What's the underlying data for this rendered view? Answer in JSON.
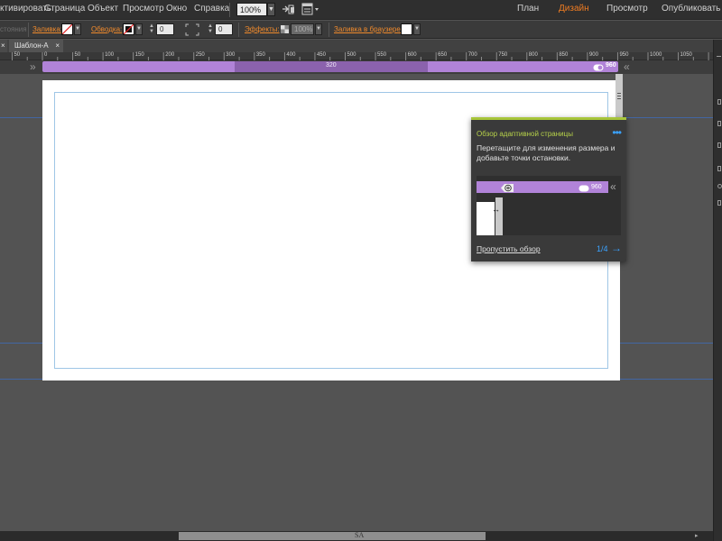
{
  "menu": {
    "items": [
      "ктивировать",
      "Страница",
      "Объект",
      "Просмотр",
      "Окно",
      "Справка"
    ],
    "zoom": "100%",
    "modes": [
      "План",
      "Дизайн",
      "Просмотр",
      "Опубликовать"
    ],
    "active_mode": "Дизайн",
    "accent_color": "#f07c22"
  },
  "controls": {
    "state_label": "стояния",
    "fill_label": "Заливка:",
    "stroke_label": "Обводка:",
    "stroke_width": "0",
    "radius": "0",
    "effects_label": "Эффекты:",
    "opacity": "100%",
    "browser_fill_label": "Заливка в браузере:"
  },
  "tabs": [
    {
      "label": "",
      "close": "×"
    },
    {
      "label": "Шаблон-А",
      "close": "×"
    }
  ],
  "ruler": {
    "ticks": [
      "50",
      "0",
      "50",
      "100",
      "150",
      "200",
      "250",
      "300",
      "350",
      "400",
      "450",
      "500",
      "550",
      "600",
      "650",
      "700",
      "750",
      "800",
      "850",
      "900",
      "950",
      "1000",
      "1050"
    ]
  },
  "breakpoints": {
    "left_chevron": "»",
    "right_chevron": "«",
    "marker_label": "320",
    "current_width": "960",
    "bar_color": "#b183d8",
    "marker_color": "#8b62ad"
  },
  "tour": {
    "title": "Обзор адаптивной страницы",
    "more": "•••",
    "body": "Перетащите для изменения размера и добавьте точки остановки.",
    "preview_width": "960",
    "skip": "Пропустить обзор",
    "step": "1/4",
    "next_icon": "→",
    "title_color": "#b7d24a",
    "link_color": "#3aa2ff"
  },
  "status": {
    "page_label": "SA"
  }
}
